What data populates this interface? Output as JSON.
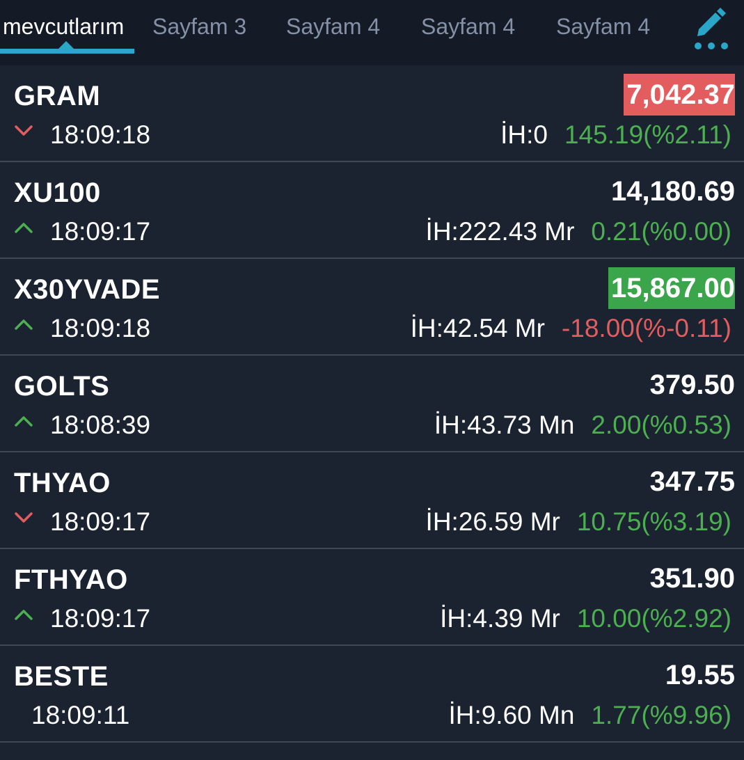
{
  "tabs": [
    {
      "label": "mevcutlarım",
      "active": true
    },
    {
      "label": "Sayfam 3",
      "active": false
    },
    {
      "label": "Sayfam 4",
      "active": false
    },
    {
      "label": "Sayfam 4",
      "active": false
    },
    {
      "label": "Sayfam 4",
      "active": false
    }
  ],
  "edit_icon": "pencil-icon",
  "more_icon": "more-dots-icon",
  "colors": {
    "accent": "#2aa6c9",
    "up": "#4caf50",
    "down": "#e35d5f",
    "flash_up": "#3aa54a",
    "flash_down": "#e35d5f",
    "background": "#1b2331",
    "header_background": "#141b27"
  },
  "rows": [
    {
      "symbol": "GRAM",
      "price": "7,042.37",
      "flash": "red",
      "direction": "down",
      "time": "18:09:18",
      "volume": "İH:0",
      "change": "145.19",
      "change_pct": "(%2.11)",
      "change_sign": "pos"
    },
    {
      "symbol": "XU100",
      "price": "14,180.69",
      "flash": "none",
      "direction": "up",
      "time": "18:09:17",
      "volume": "İH:222.43 Mr",
      "change": "0.21",
      "change_pct": "(%0.00)",
      "change_sign": "pos"
    },
    {
      "symbol": "X30YVADE",
      "price": "15,867.00",
      "flash": "green",
      "direction": "up",
      "time": "18:09:18",
      "volume": "İH:42.54 Mr",
      "change": "-18.00",
      "change_pct": "(%-0.11)",
      "change_sign": "neg"
    },
    {
      "symbol": "GOLTS",
      "price": "379.50",
      "flash": "none",
      "direction": "up",
      "time": "18:08:39",
      "volume": "İH:43.73 Mn",
      "change": "2.00",
      "change_pct": "(%0.53)",
      "change_sign": "pos"
    },
    {
      "symbol": "THYAO",
      "price": "347.75",
      "flash": "none",
      "direction": "down",
      "time": "18:09:17",
      "volume": "İH:26.59 Mr",
      "change": "10.75",
      "change_pct": "(%3.19)",
      "change_sign": "pos"
    },
    {
      "symbol": "FTHYAO",
      "price": "351.90",
      "flash": "none",
      "direction": "up",
      "time": "18:09:17",
      "volume": "İH:4.39 Mr",
      "change": "10.00",
      "change_pct": "(%2.92)",
      "change_sign": "pos"
    },
    {
      "symbol": "BESTE",
      "price": "19.55",
      "flash": "none",
      "direction": "none",
      "time": "18:09:11",
      "volume": "İH:9.60 Mn",
      "change": "1.77",
      "change_pct": "(%9.96)",
      "change_sign": "pos"
    }
  ]
}
